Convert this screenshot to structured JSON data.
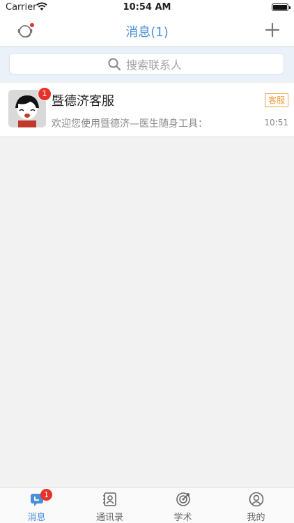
{
  "status_bar": {
    "carrier": "Carrier",
    "time": "10:54 AM"
  },
  "nav": {
    "title": "消息(1)",
    "left_icon": "customer-service-icon",
    "right_icon": "plus-icon"
  },
  "search": {
    "placeholder": "搜索联系人"
  },
  "conversations": [
    {
      "name": "暨德济客服",
      "tag": "客服",
      "preview": "欢迎您使用暨德济—医生随身工具：",
      "time": "10:51",
      "unread": "1"
    }
  ],
  "tabbar": {
    "items": [
      {
        "label": "消息",
        "icon": "message-icon",
        "badge": "1",
        "active": true
      },
      {
        "label": "通讯录",
        "icon": "contacts-icon",
        "active": false
      },
      {
        "label": "学术",
        "icon": "academic-icon",
        "active": false
      },
      {
        "label": "我的",
        "icon": "profile-icon",
        "active": false
      }
    ]
  },
  "colors": {
    "accent": "#4a8fd8",
    "badge": "#e5332a",
    "tag": "#f0a040",
    "search_bg": "#eaf1f8",
    "page_bg": "#f2f2f2"
  }
}
